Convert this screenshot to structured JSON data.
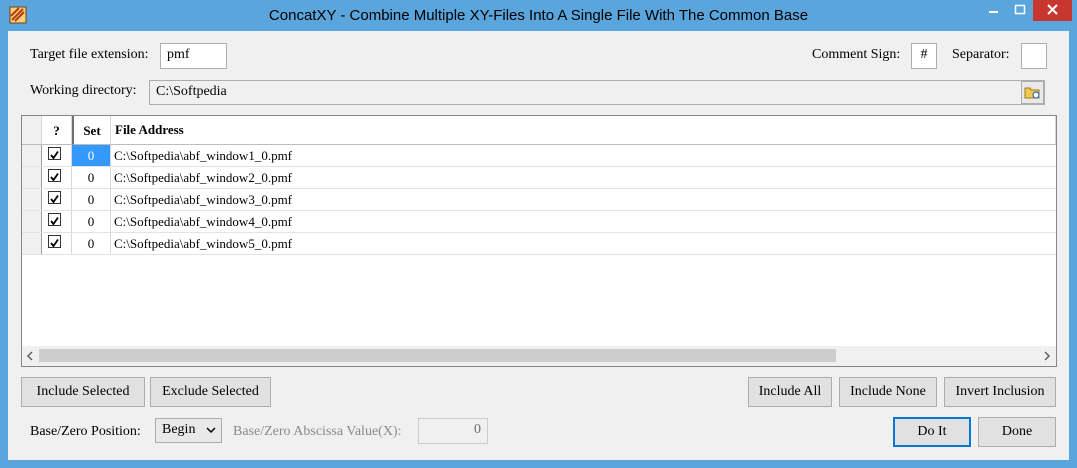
{
  "window": {
    "title": "ConcatXY - Combine Multiple XY-Files Into A Single File With The Common Base"
  },
  "form": {
    "target_ext_label": "Target file extension:",
    "target_ext_value": "pmf",
    "comment_sign_label": "Comment Sign:",
    "comment_sign_value": "#",
    "separator_label": "Separator:",
    "separator_value": "",
    "working_dir_label": "Working directory:",
    "working_dir_value": "C:\\Softpedia"
  },
  "grid": {
    "headers": {
      "include": "?",
      "set": "Set",
      "file": "File Address"
    },
    "rows": [
      {
        "included": true,
        "set": "0",
        "file": "C:\\Softpedia\\abf_window1_0.pmf"
      },
      {
        "included": true,
        "set": "0",
        "file": "C:\\Softpedia\\abf_window2_0.pmf"
      },
      {
        "included": true,
        "set": "0",
        "file": "C:\\Softpedia\\abf_window3_0.pmf"
      },
      {
        "included": true,
        "set": "0",
        "file": "C:\\Softpedia\\abf_window4_0.pmf"
      },
      {
        "included": true,
        "set": "0",
        "file": "C:\\Softpedia\\abf_window5_0.pmf"
      }
    ]
  },
  "buttons": {
    "include_selected": "Include Selected",
    "exclude_selected": "Exclude Selected",
    "include_all": "Include All",
    "include_none": "Include None",
    "invert_inclusion": "Invert Inclusion",
    "do_it": "Do It",
    "done": "Done"
  },
  "bottom": {
    "base_zero_label": "Base/Zero Position:",
    "base_zero_value": "Begin",
    "abscissa_label": "Base/Zero Abscissa Value(X):",
    "abscissa_value": "0"
  },
  "colors": {
    "titlebar": "#5aa5dc",
    "close_button": "#c7372f",
    "selection": "#3399ff",
    "default_button_border": "#0078d7"
  }
}
